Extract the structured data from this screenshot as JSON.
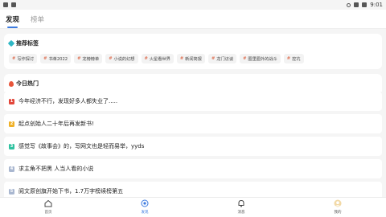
{
  "status_bar": {
    "time": "9:01"
  },
  "top_tabs": [
    {
      "label": "发现",
      "active": true
    },
    {
      "label": "榜单",
      "active": false
    }
  ],
  "recommended_tags": {
    "title": "推荐标签",
    "icon": "tag-icon",
    "tags": [
      "写作探讨",
      "书单2022",
      "龙榜榜单",
      "小说的幻想",
      "火星看世界",
      "新闻简报",
      "龙门访谈",
      "圈里圈外的战斗",
      "控坑"
    ]
  },
  "hot_today": {
    "title": "今日热门",
    "icon": "fire-icon",
    "items": [
      {
        "rank": "1",
        "text": "今年经济不行，发现好多人都失业了.....",
        "color": "#e2463a"
      },
      {
        "rank": "2",
        "text": "起点创始人二十年后再发新书!",
        "color": "#f0b128"
      },
      {
        "rank": "3",
        "text": "感觉写《故事会》的，写网文也是轻而易举，yyds",
        "color": "#2fc2a0"
      },
      {
        "rank": "4",
        "text": "求主角不把黑 人当人看的小说",
        "color": "#a9b7d0"
      },
      {
        "rank": "5",
        "text": "阅文原创旗开始下书，1.7万字榜续榜第五",
        "color": "#a9b7d0"
      }
    ]
  },
  "bottom_nav": [
    {
      "label": "首页",
      "icon": "home-icon",
      "active": false
    },
    {
      "label": "发现",
      "icon": "discover-icon",
      "active": true
    },
    {
      "label": "消息",
      "icon": "bell-icon",
      "active": false
    },
    {
      "label": "我的",
      "icon": "avatar-icon",
      "active": false
    }
  ],
  "colors": {
    "accent": "#3d7be0",
    "tag_hash": "#e07a5f"
  }
}
